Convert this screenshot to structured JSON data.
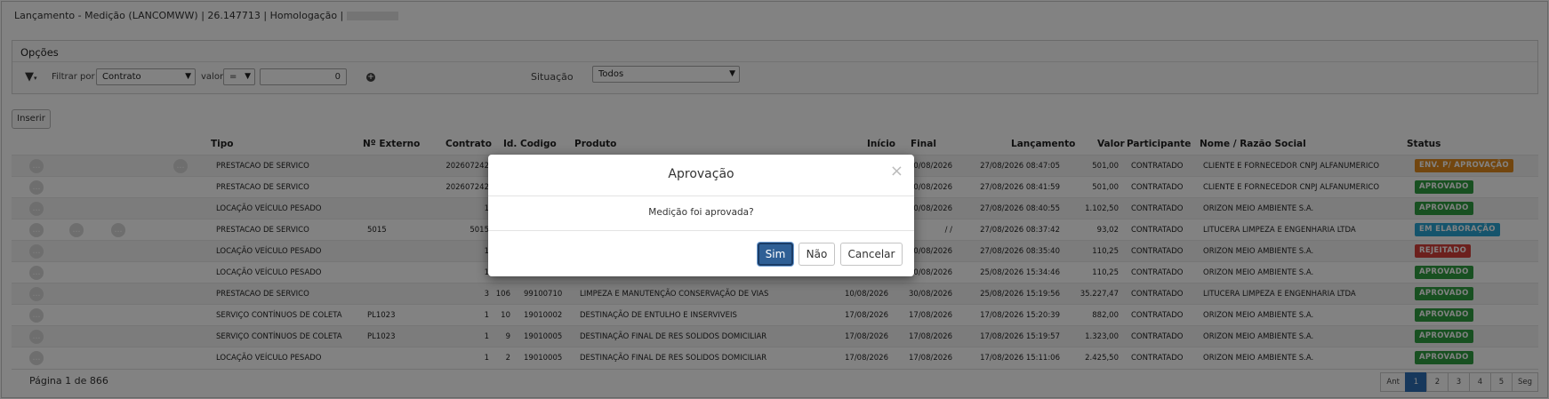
{
  "window": {
    "title": "Lançamento - Medição (LANCOMWW) | 26.147713 | Homologação |"
  },
  "options": {
    "title": "Opções",
    "filter_by_label": "Filtrar por",
    "filter_field": "Contrato",
    "valor_label": "valor",
    "operator": "=",
    "value": "0",
    "situacao_label": "Situação",
    "situacao_value": "Todos"
  },
  "toolbar": {
    "insert_label": "Inserir"
  },
  "table": {
    "headers": {
      "tipo": "Tipo",
      "externo": "Nº Externo",
      "contrato": "Contrato",
      "id": "Id.",
      "codigo": "Codigo",
      "produto": "Produto",
      "inicio": "Início",
      "final": "Final",
      "lancamento": "Lançamento",
      "valor": "Valor",
      "participante": "Participante",
      "nome": "Nome / Razão Social",
      "status": "Status"
    },
    "rows": [
      {
        "tipo": "PRESTACAO DE SERVICO",
        "externo": "",
        "contrato": "202607242",
        "id": "",
        "codigo": "",
        "produto": "",
        "inicio": "",
        "final": "30/08/2026",
        "lancamento": "27/08/2026 08:47:05",
        "valor": "501,00",
        "participante": "CONTRATADO",
        "nome": "CLIENTE E FORNECEDOR CNPJ ALFANUMERICO",
        "status": "ENV. P/ APROVAÇÃO"
      },
      {
        "tipo": "PRESTACAO DE SERVICO",
        "externo": "",
        "contrato": "202607242",
        "id": "",
        "codigo": "",
        "produto": "",
        "inicio": "",
        "final": "30/08/2026",
        "lancamento": "27/08/2026 08:41:59",
        "valor": "501,00",
        "participante": "CONTRATADO",
        "nome": "CLIENTE E FORNECEDOR CNPJ ALFANUMERICO",
        "status": "APROVADO"
      },
      {
        "tipo": "LOCAÇÃO VEÍCULO PESADO",
        "externo": "",
        "contrato": "1",
        "id": "",
        "codigo": "",
        "produto": "",
        "inicio": "",
        "final": "30/08/2026",
        "lancamento": "27/08/2026 08:40:55",
        "valor": "1.102,50",
        "participante": "CONTRATADO",
        "nome": "ORIZON MEIO AMBIENTE S.A.",
        "status": "APROVADO"
      },
      {
        "tipo": "PRESTACAO DE SERVICO",
        "externo": "5015",
        "contrato": "5015",
        "id": "",
        "codigo": "",
        "produto": "",
        "inicio": "",
        "final": "/ /",
        "lancamento": "27/08/2026 08:37:42",
        "valor": "93,02",
        "participante": "CONTRATADO",
        "nome": "LITUCERA LIMPEZA E ENGENHARIA LTDA",
        "status": "EM ELABORAÇÃO"
      },
      {
        "tipo": "LOCAÇÃO VEÍCULO PESADO",
        "externo": "",
        "contrato": "1",
        "id": "",
        "codigo": "",
        "produto": "",
        "inicio": "",
        "final": "30/08/2026",
        "lancamento": "27/08/2026 08:35:40",
        "valor": "110,25",
        "participante": "CONTRATADO",
        "nome": "ORIZON MEIO AMBIENTE S.A.",
        "status": "REJEITADO"
      },
      {
        "tipo": "LOCAÇÃO VEÍCULO PESADO",
        "externo": "",
        "contrato": "1",
        "id": "",
        "codigo": "",
        "produto": "",
        "inicio": "",
        "final": "30/08/2026",
        "lancamento": "25/08/2026 15:34:46",
        "valor": "110,25",
        "participante": "CONTRATADO",
        "nome": "ORIZON MEIO AMBIENTE S.A.",
        "status": "APROVADO"
      },
      {
        "tipo": "PRESTACAO DE SERVICO",
        "externo": "",
        "contrato": "3",
        "id": "106",
        "codigo": "99100710",
        "produto": "LIMPEZA E MANUTENÇÃO CONSERVAÇÃO DE VIAS",
        "inicio": "10/08/2026",
        "final": "30/08/2026",
        "lancamento": "25/08/2026 15:19:56",
        "valor": "35.227,47",
        "participante": "CONTRATADO",
        "nome": "LITUCERA LIMPEZA E ENGENHARIA LTDA",
        "status": "APROVADO"
      },
      {
        "tipo": "SERVIÇO CONTÍNUOS DE COLETA",
        "externo": "PL1023",
        "contrato": "1",
        "id": "10",
        "codigo": "19010002",
        "produto": "DESTINAÇÃO DE ENTULHO E INSERVIVEIS",
        "inicio": "17/08/2026",
        "final": "17/08/2026",
        "lancamento": "17/08/2026 15:20:39",
        "valor": "882,00",
        "participante": "CONTRATADO",
        "nome": "ORIZON MEIO AMBIENTE S.A.",
        "status": "APROVADO"
      },
      {
        "tipo": "SERVIÇO CONTÍNUOS DE COLETA",
        "externo": "PL1023",
        "contrato": "1",
        "id": "9",
        "codigo": "19010005",
        "produto": "DESTINAÇÃO FINAL DE RES SOLIDOS DOMICILIAR",
        "inicio": "17/08/2026",
        "final": "17/08/2026",
        "lancamento": "17/08/2026 15:19:57",
        "valor": "1.323,00",
        "participante": "CONTRATADO",
        "nome": "ORIZON MEIO AMBIENTE S.A.",
        "status": "APROVADO"
      },
      {
        "tipo": "LOCAÇÃO VEÍCULO PESADO",
        "externo": "",
        "contrato": "1",
        "id": "2",
        "codigo": "19010005",
        "produto": "DESTINAÇÃO FINAL DE RES SOLIDOS DOMICILIAR",
        "inicio": "17/08/2026",
        "final": "17/08/2026",
        "lancamento": "17/08/2026 15:11:06",
        "valor": "2.425,50",
        "participante": "CONTRATADO",
        "nome": "ORIZON MEIO AMBIENTE S.A.",
        "status": "APROVADO"
      }
    ]
  },
  "status_colors": {
    "ENV. P/ APROVAÇÃO": "#e08a1e",
    "APROVADO": "#2f9e41",
    "EM ELABORAÇÃO": "#2aa6d5",
    "REJEITADO": "#d43f3a"
  },
  "pagination": {
    "info": "Página 1 de 866",
    "prev": "Ant",
    "pages": [
      "1",
      "2",
      "3",
      "4",
      "5"
    ],
    "next": "Seg"
  },
  "modal": {
    "title": "Aprovação",
    "close": "×",
    "message": "Medição foi aprovada?",
    "yes_label": "Sim",
    "no_label": "Não",
    "cancel_label": "Cancelar"
  }
}
